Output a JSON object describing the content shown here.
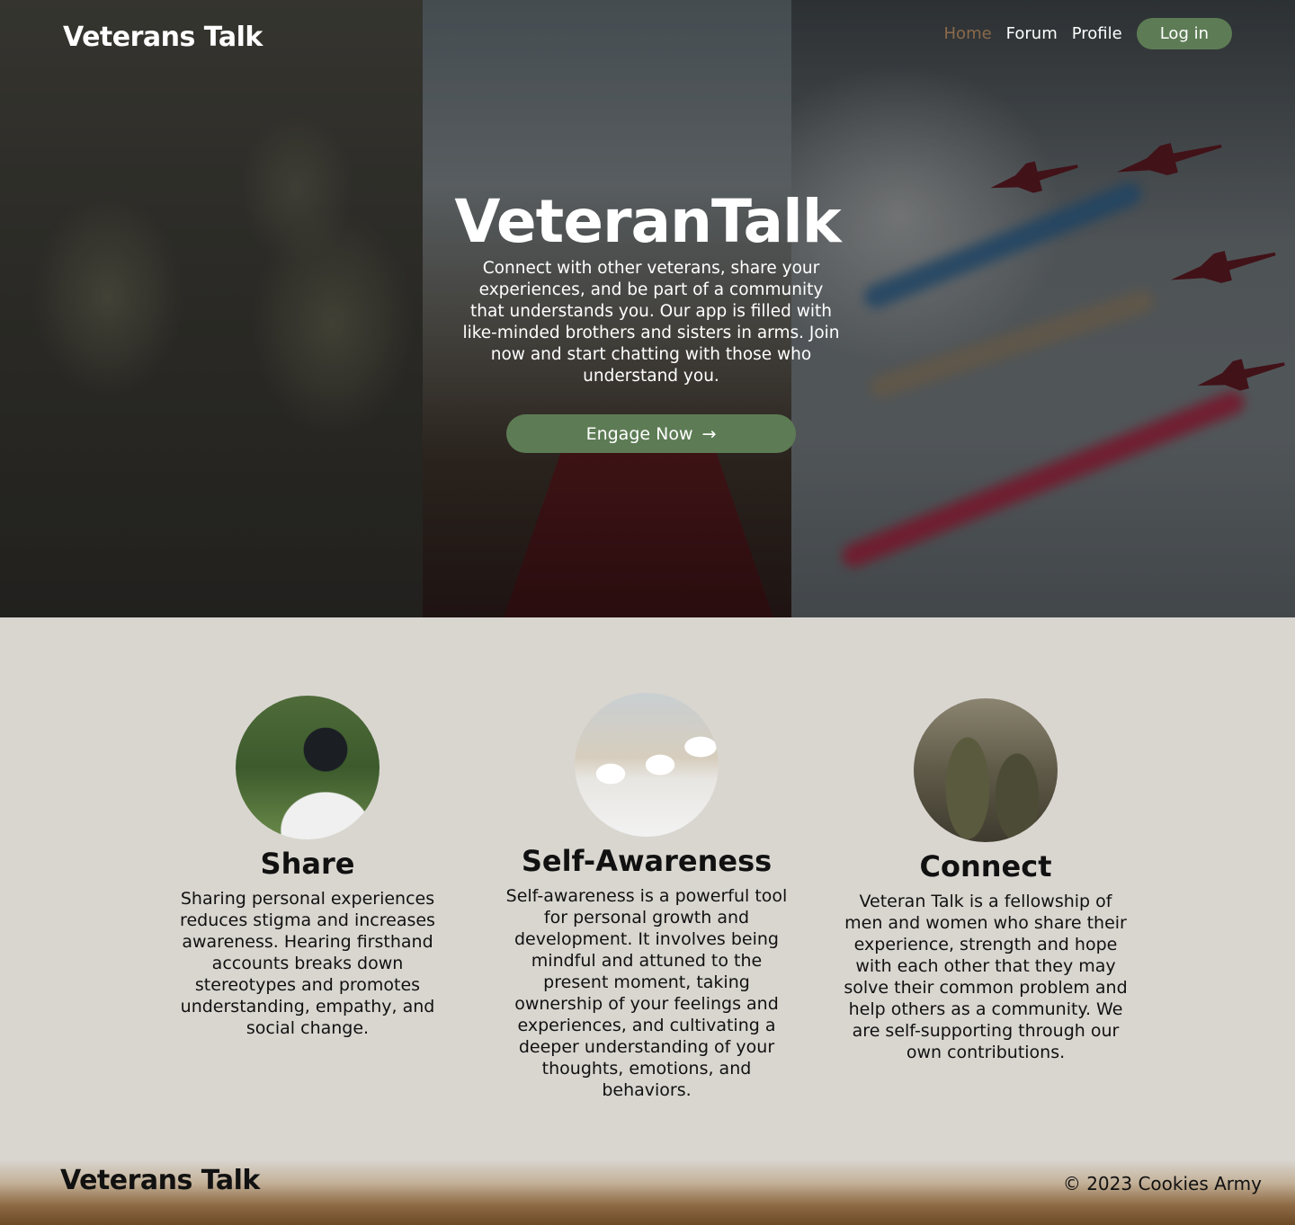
{
  "nav": {
    "brand": "Veterans Talk",
    "links": [
      {
        "label": "Home",
        "active": true
      },
      {
        "label": "Forum",
        "active": false
      },
      {
        "label": "Profile",
        "active": false
      }
    ],
    "login_label": "Log in"
  },
  "hero": {
    "title": "VeteranTalk",
    "text": "Connect with other veterans, share your experiences, and be part of a community that understands you. Our app is filled with like-minded brothers and sisters in arms. Join now and start chatting with those who understand you.",
    "cta_label": "Engage Now",
    "cta_icon": "→"
  },
  "features": [
    {
      "title": "Share",
      "text": "Sharing personal experiences reduces stigma and increases awareness. Hearing firsthand accounts breaks down stereotypes and promotes understanding, empathy, and social change."
    },
    {
      "title": "Self-Awareness",
      "text": "Self-awareness is a powerful tool for personal growth and development. It involves being mindful and attuned to the present moment, taking ownership of your feelings and experiences, and cultivating a deeper understanding of your thoughts, emotions, and behaviors."
    },
    {
      "title": "Connect",
      "text": "Veteran Talk is a fellowship of men and women who share their experience, strength and hope with each other that they may solve their common problem and help others as a community. We are self-supporting through our own contributions."
    }
  ],
  "footer": {
    "brand": "Veterans Talk",
    "copyright": "© 2023 Cookies Army"
  },
  "colors": {
    "accent_green": "#5d7c55",
    "active_link": "#8b6a4a",
    "page_bg": "#d9d6d0"
  }
}
